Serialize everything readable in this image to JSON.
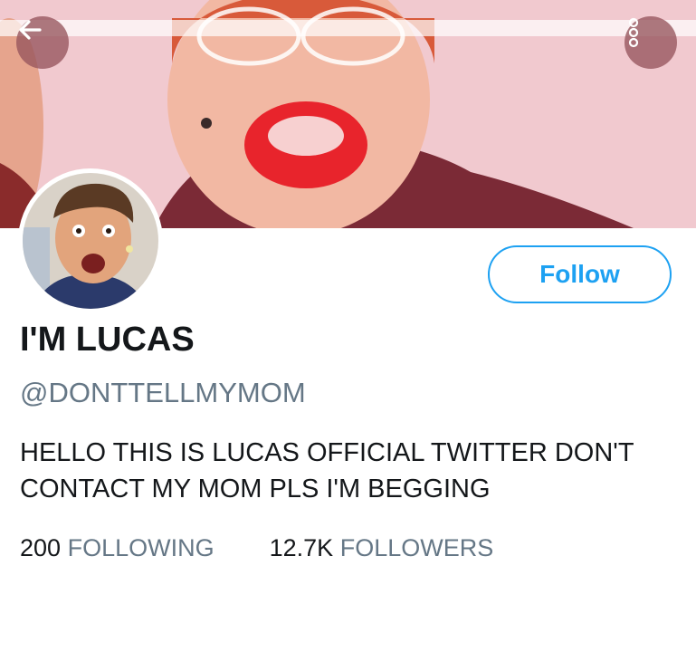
{
  "header": {
    "banner_image": "profile-header-photo",
    "back_icon": "arrow-left-icon",
    "more_icon": "more-options-icon"
  },
  "profile": {
    "avatar_image": "profile-avatar-photo",
    "display_name": "I'M LUCAS",
    "handle": "@DONTTELLMYMOM",
    "bio_line_1": "HELLO THIS IS LUCAS OFFICIAL TWITTER DON'T",
    "bio_line_2": "CONTACT MY MOM PLS I'M BEGGING",
    "follow_label": "Follow"
  },
  "stats": {
    "following_count": "200",
    "following_label": "FOLLOWING",
    "followers_count": "12.7K",
    "followers_label": "FOLLOWERS"
  },
  "colors": {
    "accent": "#1da1f2",
    "text_primary": "#14171a",
    "text_secondary": "#657786"
  }
}
